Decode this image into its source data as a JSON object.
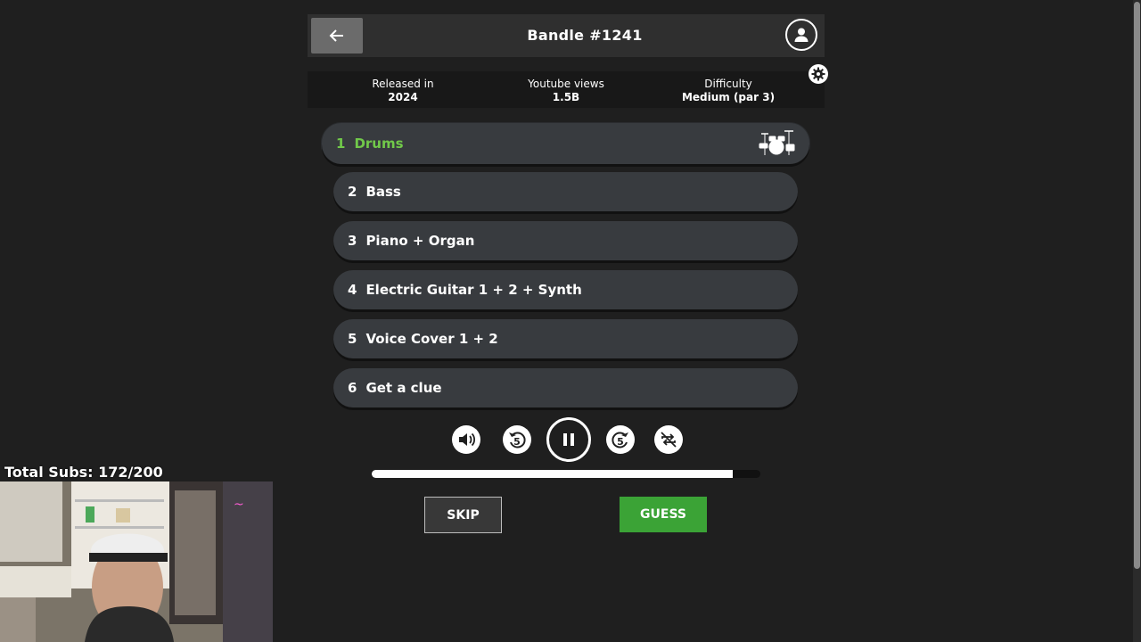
{
  "header": {
    "title": "Bandle #1241",
    "back_icon": "arrow-left-icon",
    "profile_icon": "user-icon"
  },
  "info": {
    "released_label": "Released in",
    "released_value": "2024",
    "views_label": "Youtube views",
    "views_value": "1.5B",
    "difficulty_label": "Difficulty",
    "difficulty_value": "Medium (par 3)",
    "settings_icon": "gear-icon"
  },
  "tracks": [
    {
      "num": "1",
      "label": "Drums",
      "state": "active"
    },
    {
      "num": "2",
      "label": "Bass"
    },
    {
      "num": "3",
      "label": "Piano + Organ"
    },
    {
      "num": "4",
      "label": "Electric Guitar 1 + 2 + Synth"
    },
    {
      "num": "5",
      "label": "Voice Cover 1 + 2"
    },
    {
      "num": "6",
      "label": "Get a clue"
    }
  ],
  "player": {
    "controls": [
      "volume-icon",
      "rewind-5-icon",
      "pause-icon",
      "forward-5-icon",
      "no-repeat-icon"
    ],
    "rewind_seconds": "5",
    "forward_seconds": "5",
    "progress_fraction": 0.93
  },
  "actions": {
    "skip_label": "SKIP",
    "guess_label": "GUESS"
  },
  "overlay": {
    "subs_text": "Total Subs: 172/200"
  },
  "colors": {
    "accent_green": "#3ba336",
    "active_track": "#71c94a",
    "background": "#1f1f1f",
    "row_bg": "#383b3f"
  }
}
